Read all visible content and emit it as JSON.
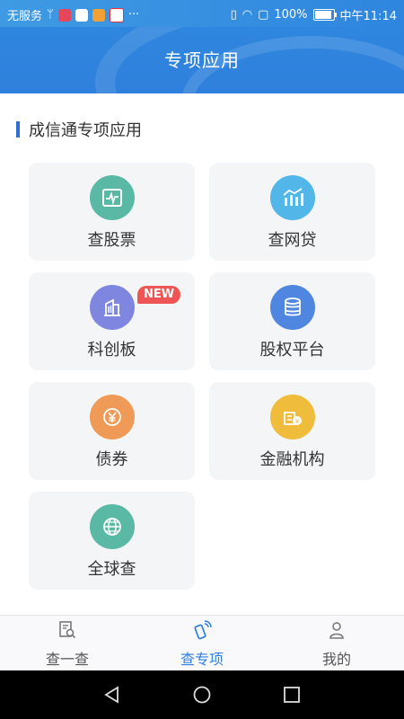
{
  "status_bar": {
    "carrier": "无服务",
    "battery": "100%",
    "time": "中午11:14",
    "more": "···",
    "battery_level_fraction": 1.0
  },
  "header": {
    "title": "专项应用"
  },
  "section": {
    "title": "成信通专项应用"
  },
  "cards": [
    {
      "label": "查股票",
      "icon": "stock-chart-icon",
      "color": "#59b9a4"
    },
    {
      "label": "查网贷",
      "icon": "bar-chart-icon",
      "color": "#52b6e8"
    },
    {
      "label": "科创板",
      "icon": "building-icon",
      "color": "#7f86e0",
      "badge": "NEW"
    },
    {
      "label": "股权平台",
      "icon": "database-stack-icon",
      "color": "#4f86e0"
    },
    {
      "label": "债券",
      "icon": "yuan-coin-icon",
      "color": "#f09a57"
    },
    {
      "label": "金融机构",
      "icon": "finance-institution-icon",
      "color": "#efbd3b"
    },
    {
      "label": "全球查",
      "icon": "globe-icon",
      "color": "#59b9a4"
    }
  ],
  "tabs": [
    {
      "label": "查一查",
      "icon": "search-doc-icon",
      "active": false
    },
    {
      "label": "查专项",
      "icon": "phone-signal-icon",
      "active": true
    },
    {
      "label": "我的",
      "icon": "user-icon",
      "active": false
    }
  ],
  "colors": {
    "header_blue": "#2f86de",
    "active_tab": "#2f7fdc",
    "badge_red": "#ee5656"
  }
}
